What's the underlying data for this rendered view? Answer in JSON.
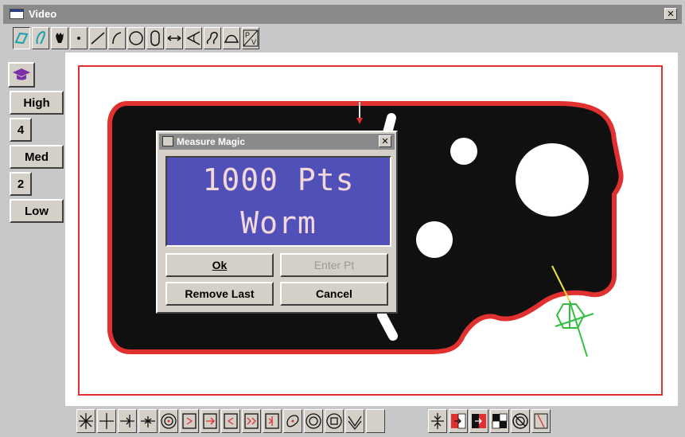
{
  "window": {
    "title": "Video",
    "close_glyph": "✕"
  },
  "top_toolbar": {
    "icons": [
      "select-rect-icon",
      "select-lasso-icon",
      "hand-probe-icon",
      "point-icon",
      "line-icon",
      "arc-icon",
      "circle-icon",
      "slot-icon",
      "distance-icon",
      "angle-icon",
      "freeform-icon",
      "arch-icon",
      "pv-icon"
    ],
    "pv_label": "PV"
  },
  "left_panel": {
    "buttons": [
      "High",
      "4",
      "Med",
      "2",
      "Low"
    ]
  },
  "dialog": {
    "title": "Measure Magic",
    "close_glyph": "✕",
    "display_line1": "1000 Pts",
    "display_line2": "Worm",
    "ok_label": "Ok",
    "enter_pt_label": "Enter Pt",
    "remove_last_label": "Remove Last",
    "cancel_label": "Cancel",
    "enter_pt_enabled": false
  },
  "bottom_toolbar": {
    "icons": [
      "crosshair-star-icon",
      "crosshair-plus-icon",
      "edge-right-icon",
      "edge-both-icon",
      "target-circle-icon",
      "edge-box-icon",
      "edge-box-arrow-icon",
      "edge-box-left-icon",
      "edge-box-right-icon",
      "edge-box-double-icon",
      "blob-icon",
      "ring-icon",
      "square-circle-icon",
      "v-notch-icon",
      "blank-icon",
      "focus-icon",
      "contrast-right-icon",
      "contrast-left-icon",
      "checker-icon",
      "no-circle-icon",
      "no-line-icon"
    ]
  },
  "colors": {
    "accent_red": "#e03030",
    "display_blue": "#5050b8",
    "part_black": "#101010",
    "overlay_yellow": "#f0e040",
    "overlay_green": "#30c040"
  }
}
